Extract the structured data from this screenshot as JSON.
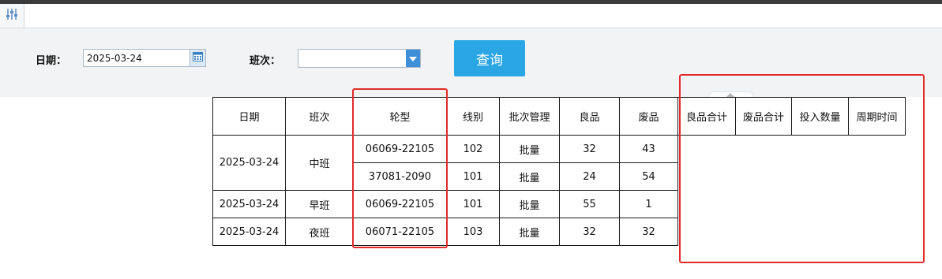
{
  "filters": {
    "date_label": "日期：",
    "date_value": "2025-03-24",
    "shift_label": "班次：",
    "shift_value": "",
    "query_label": "查询"
  },
  "table": {
    "headers": [
      "日期",
      "班次",
      "轮型",
      "线别",
      "批次管理",
      "良品",
      "废品",
      "良品合计",
      "废品合计",
      "投入数量",
      "周期时间"
    ],
    "rows": [
      {
        "date": "2025-03-24",
        "shift": "中班",
        "wheel_type": "06069-22105",
        "line": "102",
        "batch": "批量",
        "good": "32",
        "scrap": "43"
      },
      {
        "wheel_type": "37081-2090",
        "line": "101",
        "batch": "批量",
        "good": "24",
        "scrap": "54"
      },
      {
        "date": "2025-03-24",
        "shift": "早班",
        "wheel_type": "06069-22105",
        "line": "101",
        "batch": "批量",
        "good": "55",
        "scrap": "1"
      },
      {
        "date": "2025-03-24",
        "shift": "夜班",
        "wheel_type": "06071-22105",
        "line": "103",
        "batch": "批量",
        "good": "32",
        "scrap": "32"
      }
    ]
  },
  "colors": {
    "accent": "#2aa6e4",
    "highlight": "#e02b2b",
    "panel_bg": "#f2f3f5"
  },
  "icons": {
    "filter_tab": "sliders-icon",
    "date_picker": "calendar-icon",
    "dropdown": "caret-down-icon"
  }
}
